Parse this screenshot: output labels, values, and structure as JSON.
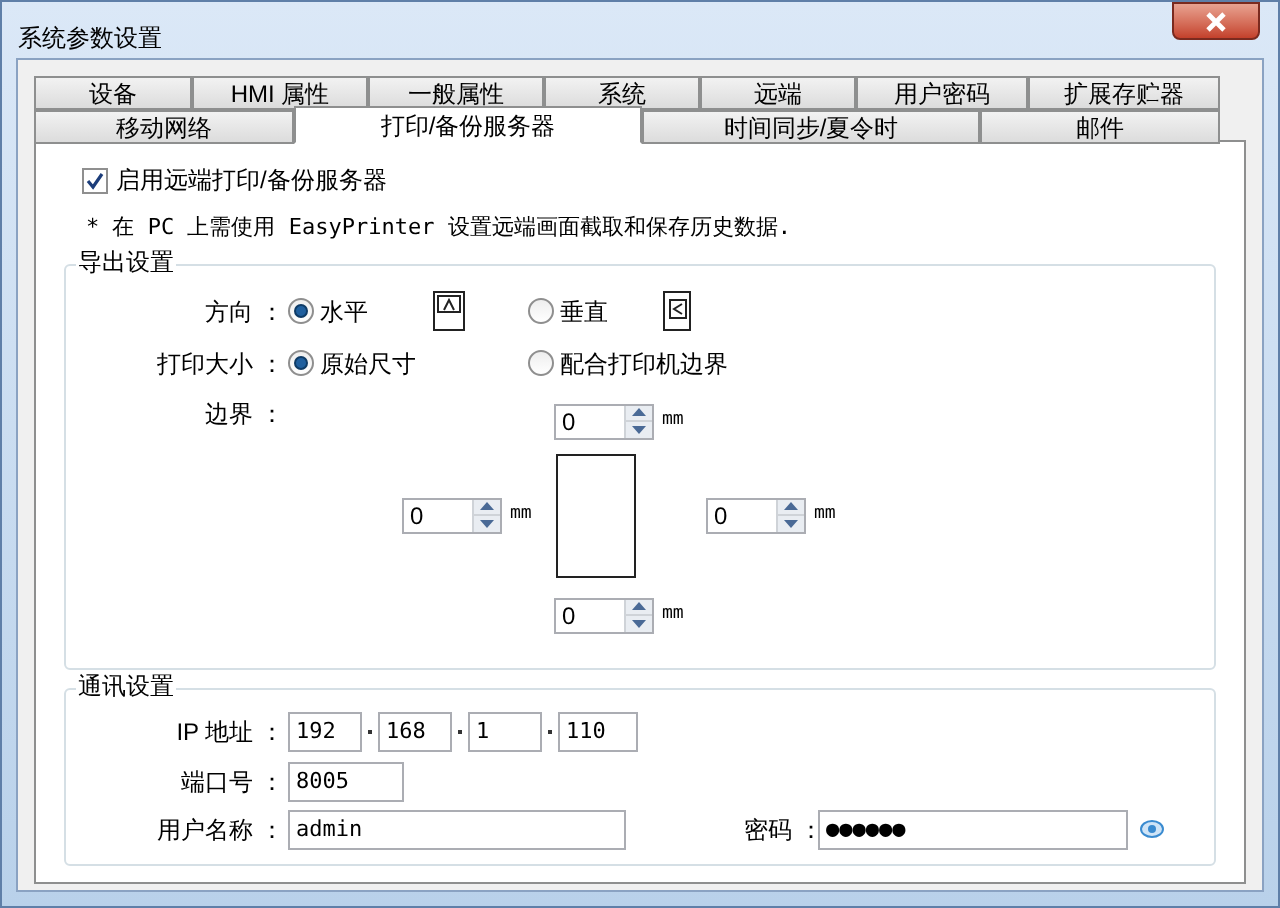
{
  "window": {
    "title": "系统参数设置"
  },
  "tabs": {
    "row_1": [
      {
        "label": "设备",
        "selected": false
      },
      {
        "label": "HMI 属性",
        "selected": false
      },
      {
        "label": "一般属性",
        "selected": false
      },
      {
        "label": "系统",
        "selected": false
      },
      {
        "label": "远端",
        "selected": false
      },
      {
        "label": "用户密码",
        "selected": false
      },
      {
        "label": "扩展存贮器",
        "selected": false
      }
    ],
    "row_2": [
      {
        "label": "移动网络",
        "selected": false
      },
      {
        "label": "打印/备份服务器",
        "selected": true
      },
      {
        "label": "时间同步/夏令时",
        "selected": false
      },
      {
        "label": "邮件",
        "selected": false
      }
    ]
  },
  "enable_remote": {
    "label": "启用远端打印/备份服务器",
    "checked": true
  },
  "note": "* 在 PC 上需使用 EasyPrinter 设置远端画面截取和保存历史数据.",
  "export_settings": {
    "title": "导出设置",
    "orientation": {
      "label": "方向 ：",
      "options": [
        {
          "label": "水平",
          "selected": true
        },
        {
          "label": "垂直",
          "selected": false
        }
      ]
    },
    "print_size": {
      "label": "打印大小 ：",
      "options": [
        {
          "label": "原始尺寸",
          "selected": true
        },
        {
          "label": "配合打印机边界",
          "selected": false
        }
      ]
    },
    "margins": {
      "label": "边界 ：",
      "top": {
        "value": "0",
        "unit": "mm"
      },
      "left": {
        "value": "0",
        "unit": "mm"
      },
      "right": {
        "value": "0",
        "unit": "mm"
      },
      "bottom": {
        "value": "0",
        "unit": "mm"
      }
    }
  },
  "comm_settings": {
    "title": "通讯设置",
    "ip": {
      "label": "IP 地址 ：",
      "octets": [
        "192",
        "168",
        "1",
        "110"
      ]
    },
    "port": {
      "label": "端口号 ：",
      "value": "8005"
    },
    "username": {
      "label": "用户名称 ：",
      "value": "admin"
    },
    "password": {
      "label": "密码 ：",
      "value": "●●●●●●"
    }
  }
}
